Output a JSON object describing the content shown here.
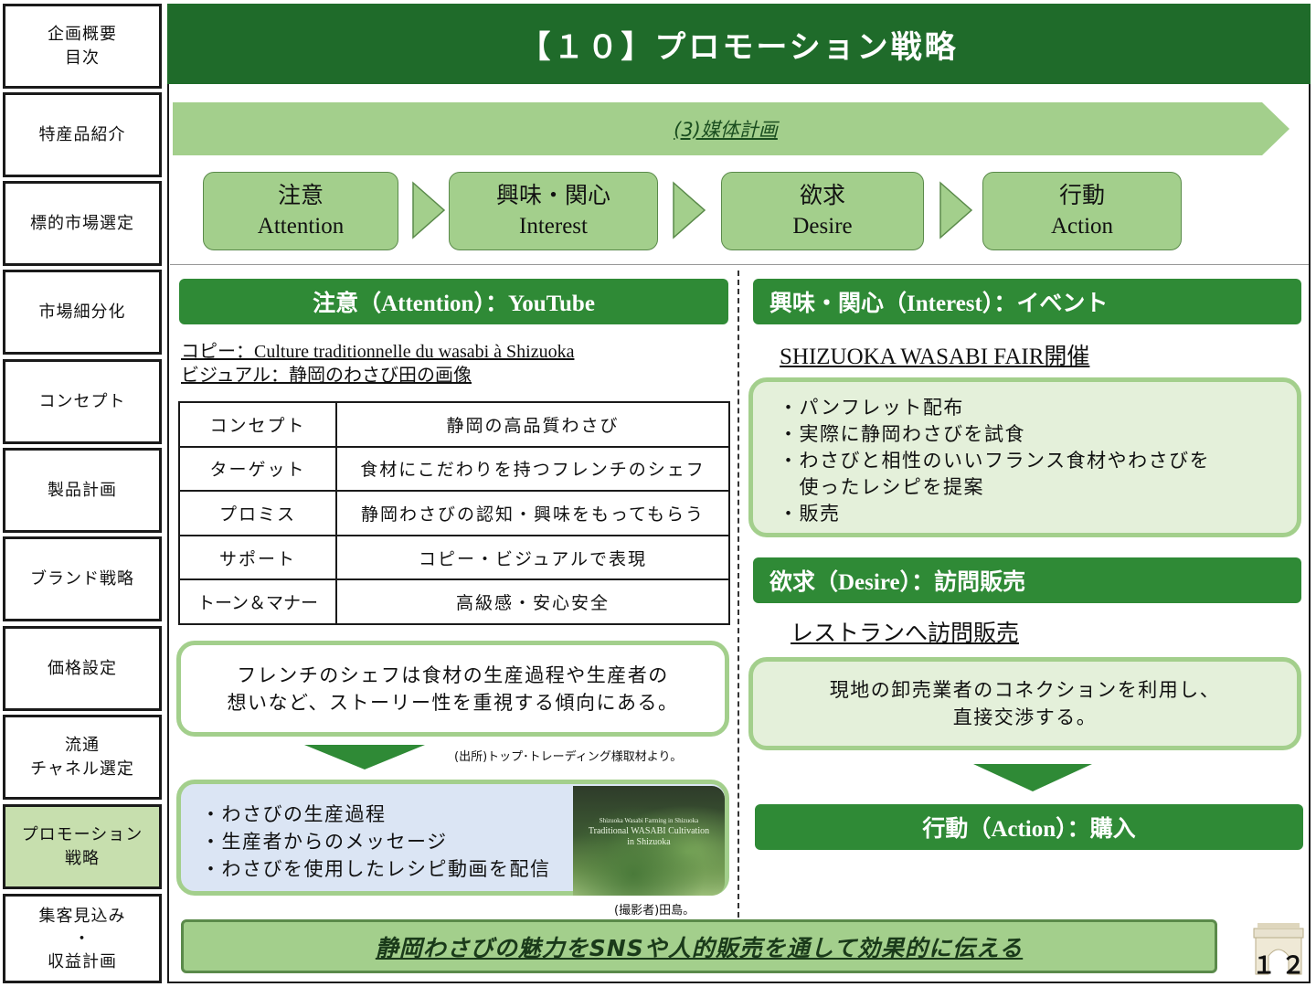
{
  "sidebar": {
    "items": [
      {
        "label": "企画概要\n目次"
      },
      {
        "label": "特産品紹介"
      },
      {
        "label": "標的市場選定"
      },
      {
        "label": "市場細分化"
      },
      {
        "label": "コンセプト"
      },
      {
        "label": "製品計画"
      },
      {
        "label": "ブランド戦略"
      },
      {
        "label": "価格設定"
      },
      {
        "label": "流通\nチャネル選定"
      },
      {
        "label": "プロモーション\n戦略"
      },
      {
        "label": "集客見込み\n・\n収益計画"
      }
    ],
    "active_index": 9
  },
  "title": "【１０】プロモーション戦略",
  "banner": "(3)媒体計画",
  "aida": [
    {
      "jp": "注意",
      "en": "Attention"
    },
    {
      "jp": "興味・関心",
      "en": "Interest"
    },
    {
      "jp": "欲求",
      "en": "Desire"
    },
    {
      "jp": "行動",
      "en": "Action"
    }
  ],
  "left": {
    "header": "注意（Attention）：YouTube",
    "copy_line": "コピー：Culture traditionnelle du wasabi à Shizuoka",
    "visual_line": "ビジュアル：静岡のわさび田の画像",
    "table": [
      {
        "key": "コンセプト",
        "value": "静岡の高品質わさび"
      },
      {
        "key": "ターゲット",
        "value": "食材にこだわりを持つフレンチのシェフ"
      },
      {
        "key": "プロミス",
        "value": "静岡わさびの認知・興味をもってもらう"
      },
      {
        "key": "サポート",
        "value": "コピー・ビジュアルで表現"
      },
      {
        "key": "トーン＆マナー",
        "value": "高級感・安心安全"
      }
    ],
    "insight": [
      "フレンチのシェフは食材の生産過程や生産者の",
      "想いなど、ストーリー性を重視する傾向にある。"
    ],
    "insight_source": "(出所)トップ･トレーディング様取材より。",
    "contents": [
      "・わさびの生産過程",
      "・生産者からのメッセージ",
      "・わさびを使用したレシピ動画を配信"
    ],
    "photo_text": [
      "Shizuoka Wasabi Farming in Shizuoka",
      "Traditional WASABI Cultivation",
      "in Shizuoka"
    ],
    "photo_credit": "(撮影者)田島。"
  },
  "right": {
    "interest_header": "興味・関心（Interest）：イベント",
    "event_title": "SHIZUOKA WASABI FAIR開催",
    "event_items": [
      "・パンフレット配布",
      "・実際に静岡わさびを試食",
      "・わさびと相性のいいフランス食材やわさびを",
      "　使ったレシピを提案",
      "・販売"
    ],
    "desire_header": "欲求（Desire）：訪問販売",
    "desire_title": "レストランへ訪問販売",
    "desire_text": [
      "現地の卸売業者のコネクションを利用し、",
      "直接交渉する。"
    ],
    "action_header": "行動（Action）：購入"
  },
  "footer": "静岡わさびの魅力をSNSや人的販売を通して効果的に伝える",
  "page_number": "１２",
  "colors": {
    "dark_green": "#1f6b2a",
    "mid_green": "#2f8a36",
    "light_green": "#a3cf8c",
    "pale_green": "#e4f0da",
    "pale_blue": "#dbe5f4"
  }
}
